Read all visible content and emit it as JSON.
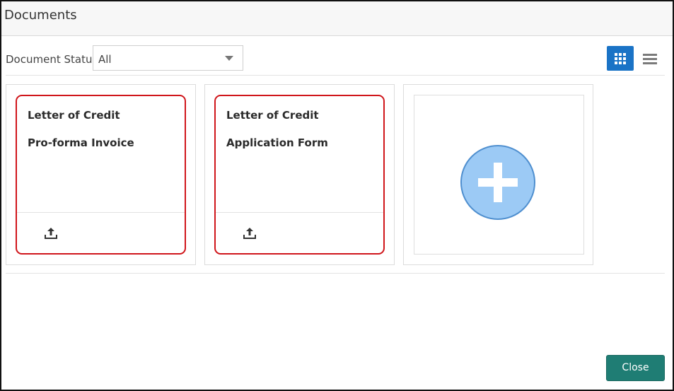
{
  "dialog": {
    "title": "Documents"
  },
  "filter": {
    "label": "Document Status",
    "selected": "All"
  },
  "view_toggle": {
    "grid_icon": "grid-view-icon",
    "list_icon": "list-view-icon",
    "active": "grid"
  },
  "cards": [
    {
      "line1": "Letter of Credit",
      "line2": "Pro-forma Invoice",
      "action_icon": "upload-icon"
    },
    {
      "line1": "Letter of Credit",
      "line2": "Application Form",
      "action_icon": "upload-icon"
    }
  ],
  "add_card": {
    "icon": "plus-circle-icon"
  },
  "footer": {
    "close_label": "Close"
  },
  "colors": {
    "accent": "#1a73c6",
    "card_border": "#d0161b",
    "close_button": "#1f7d74",
    "add_circle": "#9ccaf5"
  }
}
